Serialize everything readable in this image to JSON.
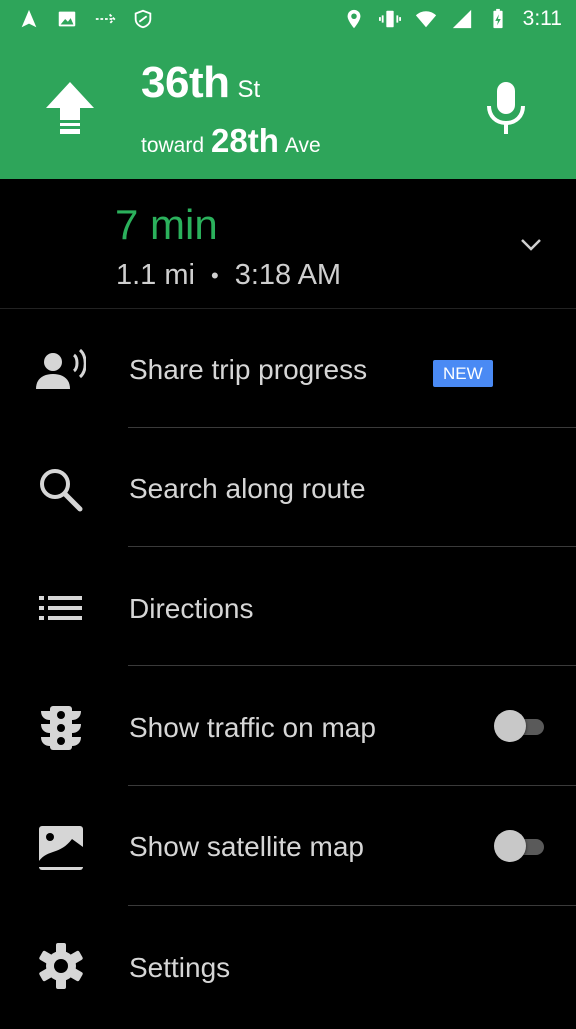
{
  "status_bar": {
    "time": "3:11",
    "left_icons": [
      "navigation-arrow-icon",
      "image-icon",
      "data-transfer-icon",
      "data-saver-icon"
    ],
    "right_icons": [
      "location-pin-icon",
      "vibrate-icon",
      "wifi-icon",
      "signal-icon",
      "battery-charging-icon"
    ],
    "background": "#2ea55a"
  },
  "nav_header": {
    "street": "36th",
    "street_suffix": "St",
    "toward_label": "toward",
    "toward_street": "28th",
    "toward_suffix": "Ave",
    "turn_icon": "arrow-up-icon",
    "mic_icon": "microphone-icon",
    "background": "#2ea55a"
  },
  "trip": {
    "eta": "7 min",
    "distance": "1.1 mi",
    "separator": "•",
    "arrival": "3:18 AM",
    "eta_color": "#2bb15c"
  },
  "menu": {
    "share": {
      "label": "Share trip progress",
      "badge": "NEW",
      "icon": "share-person-icon"
    },
    "search": {
      "label": "Search along route",
      "icon": "search-icon"
    },
    "directions": {
      "label": "Directions",
      "icon": "list-icon"
    },
    "traffic": {
      "label": "Show traffic on map",
      "icon": "traffic-light-icon",
      "enabled": false
    },
    "satellite": {
      "label": "Show satellite map",
      "icon": "satellite-image-icon",
      "enabled": false
    },
    "settings": {
      "label": "Settings",
      "icon": "gear-icon"
    }
  },
  "colors": {
    "badge": "#4a8af4",
    "text": "#d6d6d6",
    "background": "#000000"
  }
}
